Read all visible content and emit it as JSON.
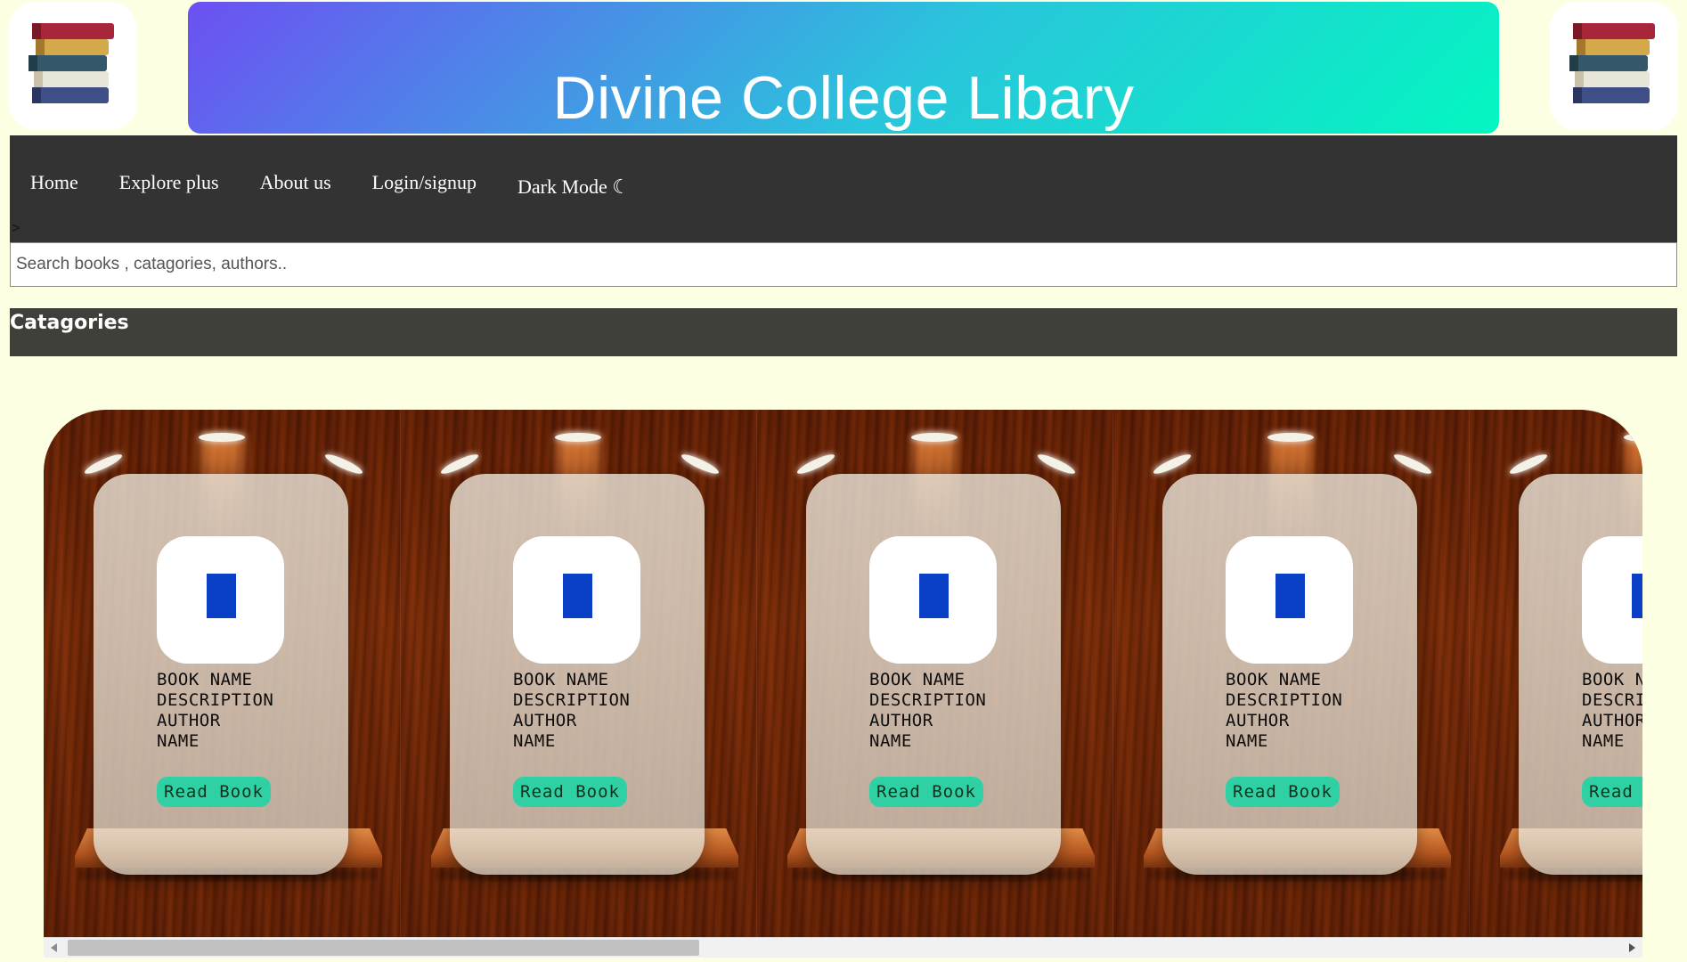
{
  "header": {
    "title": "Divine College Libary"
  },
  "nav": {
    "items": [
      "Home",
      "Explore plus",
      "About us",
      "Login/signup"
    ],
    "dark_mode_label": "Dark Mode ☾",
    "stray_text": ">"
  },
  "search": {
    "placeholder": "Search books , catagories, authors..",
    "value": ""
  },
  "categories": {
    "label": "Catagories"
  },
  "books": [
    {
      "line1": "BOOK NAME",
      "line2": "DESCRIPTION",
      "line3": "AUTHOR",
      "line4": "NAME",
      "button": "Read Book"
    },
    {
      "line1": "BOOK NAME",
      "line2": "DESCRIPTION",
      "line3": "AUTHOR",
      "line4": "NAME",
      "button": "Read Book"
    },
    {
      "line1": "BOOK NAME",
      "line2": "DESCRIPTION",
      "line3": "AUTHOR",
      "line4": "NAME",
      "button": "Read Book"
    },
    {
      "line1": "BOOK NAME",
      "line2": "DESCRIPTION",
      "line3": "AUTHOR",
      "line4": "NAME",
      "button": "Read Book"
    },
    {
      "line1": "BOOK NAME",
      "line2": "DESCRIPTION",
      "line3": "AUTHOR",
      "line4": "NAME",
      "button": "Read Book"
    }
  ],
  "icons": {
    "logo": "books-stack-icon",
    "book": "book-icon"
  },
  "colors": {
    "page_bg": "#fdffe2",
    "nav_bg": "#333333",
    "category_bar": "#3f403a",
    "button": "#2fd0a4",
    "book_icon": "#0a3fc8"
  }
}
